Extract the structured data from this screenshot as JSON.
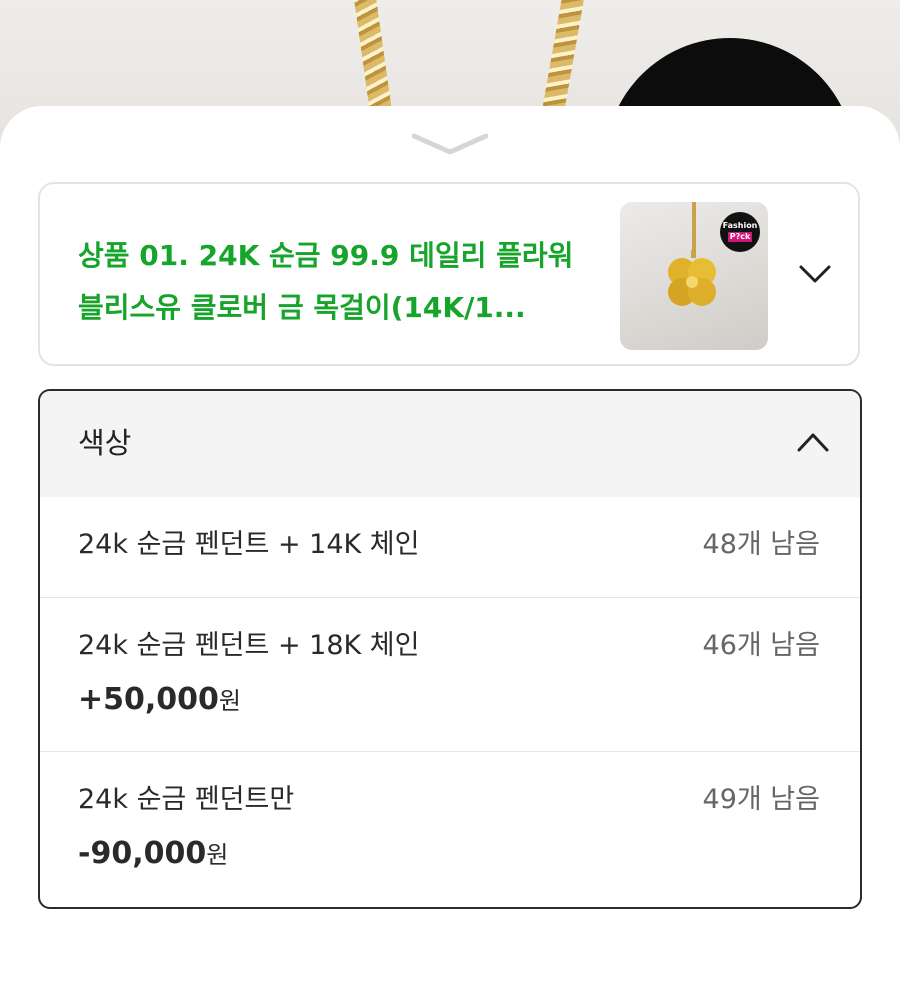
{
  "product": {
    "title": "상품 01. 24K 순금 99.9 데일리 플라워 블리스유 클로버 금 목걸이(14K/1..."
  },
  "thumbnail": {
    "badge_line1": "Fashion",
    "badge_line2": "P?ck"
  },
  "options": {
    "title": "색상",
    "items": [
      {
        "name": "24k 순금 펜던트 + 14K 체인",
        "stock": "48개 남음",
        "price": "",
        "price_unit": ""
      },
      {
        "name": "24k 순금 펜던트 + 18K 체인",
        "stock": "46개 남음",
        "price": "+50,000",
        "price_unit": "원"
      },
      {
        "name": "24k 순금 펜던트만",
        "stock": "49개 남음",
        "price": "-90,000",
        "price_unit": "원"
      }
    ]
  },
  "colors": {
    "title_green": "#16a42a",
    "border_dark": "#2b2b2b",
    "header_bg": "#f4f4f4"
  }
}
